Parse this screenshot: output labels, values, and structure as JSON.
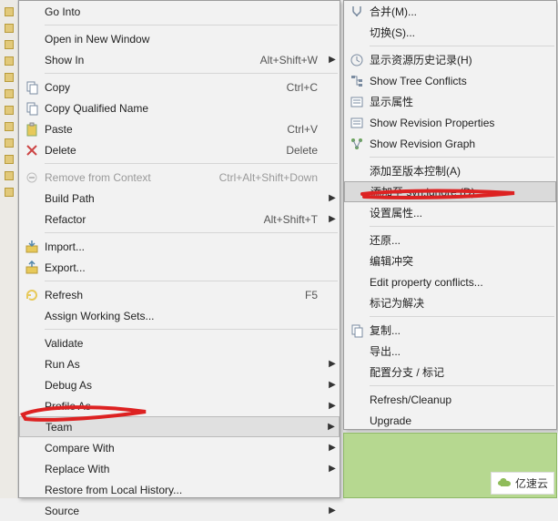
{
  "left_menu": {
    "items": [
      {
        "label": "Go Into",
        "shortcut": "",
        "arrow": false,
        "icon": "none",
        "disabled": false
      },
      {
        "sep": true
      },
      {
        "label": "Open in New Window",
        "shortcut": "",
        "arrow": false,
        "icon": "none",
        "disabled": false
      },
      {
        "label": "Show In",
        "shortcut": "Alt+Shift+W",
        "arrow": true,
        "icon": "none",
        "disabled": false
      },
      {
        "sep": true
      },
      {
        "label": "Copy",
        "shortcut": "Ctrl+C",
        "arrow": false,
        "icon": "copy",
        "disabled": false
      },
      {
        "label": "Copy Qualified Name",
        "shortcut": "",
        "arrow": false,
        "icon": "copy",
        "disabled": false
      },
      {
        "label": "Paste",
        "shortcut": "Ctrl+V",
        "arrow": false,
        "icon": "paste",
        "disabled": false
      },
      {
        "label": "Delete",
        "shortcut": "Delete",
        "arrow": false,
        "icon": "delete",
        "disabled": false
      },
      {
        "sep": true
      },
      {
        "label": "Remove from Context",
        "shortcut": "Ctrl+Alt+Shift+Down",
        "arrow": false,
        "icon": "remove",
        "disabled": true
      },
      {
        "label": "Build Path",
        "shortcut": "",
        "arrow": true,
        "icon": "none",
        "disabled": false
      },
      {
        "label": "Refactor",
        "shortcut": "Alt+Shift+T",
        "arrow": true,
        "icon": "none",
        "disabled": false
      },
      {
        "sep": true
      },
      {
        "label": "Import...",
        "shortcut": "",
        "arrow": false,
        "icon": "import",
        "disabled": false
      },
      {
        "label": "Export...",
        "shortcut": "",
        "arrow": false,
        "icon": "export",
        "disabled": false
      },
      {
        "sep": true
      },
      {
        "label": "Refresh",
        "shortcut": "F5",
        "arrow": false,
        "icon": "refresh",
        "disabled": false
      },
      {
        "label": "Assign Working Sets...",
        "shortcut": "",
        "arrow": false,
        "icon": "none",
        "disabled": false
      },
      {
        "sep": true
      },
      {
        "label": "Validate",
        "shortcut": "",
        "arrow": false,
        "icon": "none",
        "disabled": false
      },
      {
        "label": "Run As",
        "shortcut": "",
        "arrow": true,
        "icon": "none",
        "disabled": false
      },
      {
        "label": "Debug As",
        "shortcut": "",
        "arrow": true,
        "icon": "none",
        "disabled": false
      },
      {
        "label": "Profile As",
        "shortcut": "",
        "arrow": true,
        "icon": "none",
        "disabled": false
      },
      {
        "label": "Team",
        "shortcut": "",
        "arrow": true,
        "icon": "none",
        "disabled": false,
        "selected": true
      },
      {
        "label": "Compare With",
        "shortcut": "",
        "arrow": true,
        "icon": "none",
        "disabled": false
      },
      {
        "label": "Replace With",
        "shortcut": "",
        "arrow": true,
        "icon": "none",
        "disabled": false
      },
      {
        "label": "Restore from Local History...",
        "shortcut": "",
        "arrow": false,
        "icon": "none",
        "disabled": false
      },
      {
        "label": "Source",
        "shortcut": "",
        "arrow": true,
        "icon": "none",
        "disabled": false
      }
    ]
  },
  "right_menu": {
    "items": [
      {
        "label": "合并(M)...",
        "icon": "merge",
        "disabled": false
      },
      {
        "label": "切换(S)...",
        "icon": "none",
        "disabled": false
      },
      {
        "sep": true
      },
      {
        "label": "显示资源历史记录(H)",
        "icon": "history",
        "disabled": false
      },
      {
        "label": "Show Tree Conflicts",
        "icon": "tree",
        "disabled": false
      },
      {
        "label": "显示属性",
        "icon": "props",
        "disabled": false
      },
      {
        "label": "Show Revision Properties",
        "icon": "props",
        "disabled": false
      },
      {
        "label": "Show Revision Graph",
        "icon": "graph",
        "disabled": false
      },
      {
        "sep": true
      },
      {
        "label": "添加至版本控制(A)",
        "icon": "none",
        "disabled": false
      },
      {
        "label": "添加至 svn:ignore (D)",
        "icon": "none",
        "disabled": false,
        "selected": true
      },
      {
        "label": "设置属性...",
        "icon": "none",
        "disabled": false
      },
      {
        "sep": true
      },
      {
        "label": "还原...",
        "icon": "none",
        "disabled": false
      },
      {
        "label": "编辑冲突",
        "icon": "none",
        "disabled": false
      },
      {
        "label": "Edit property conflicts...",
        "icon": "none",
        "disabled": false
      },
      {
        "label": "标记为解决",
        "icon": "none",
        "disabled": false
      },
      {
        "sep": true
      },
      {
        "label": "复制...",
        "icon": "copy",
        "disabled": false
      },
      {
        "label": "导出...",
        "icon": "none",
        "disabled": false
      },
      {
        "label": "配置分支 / 标记",
        "icon": "none",
        "disabled": false
      },
      {
        "sep": true
      },
      {
        "label": "Refresh/Cleanup",
        "icon": "none",
        "disabled": false
      },
      {
        "label": "Upgrade",
        "icon": "none",
        "disabled": false
      }
    ]
  },
  "logo_text": "亿速云"
}
